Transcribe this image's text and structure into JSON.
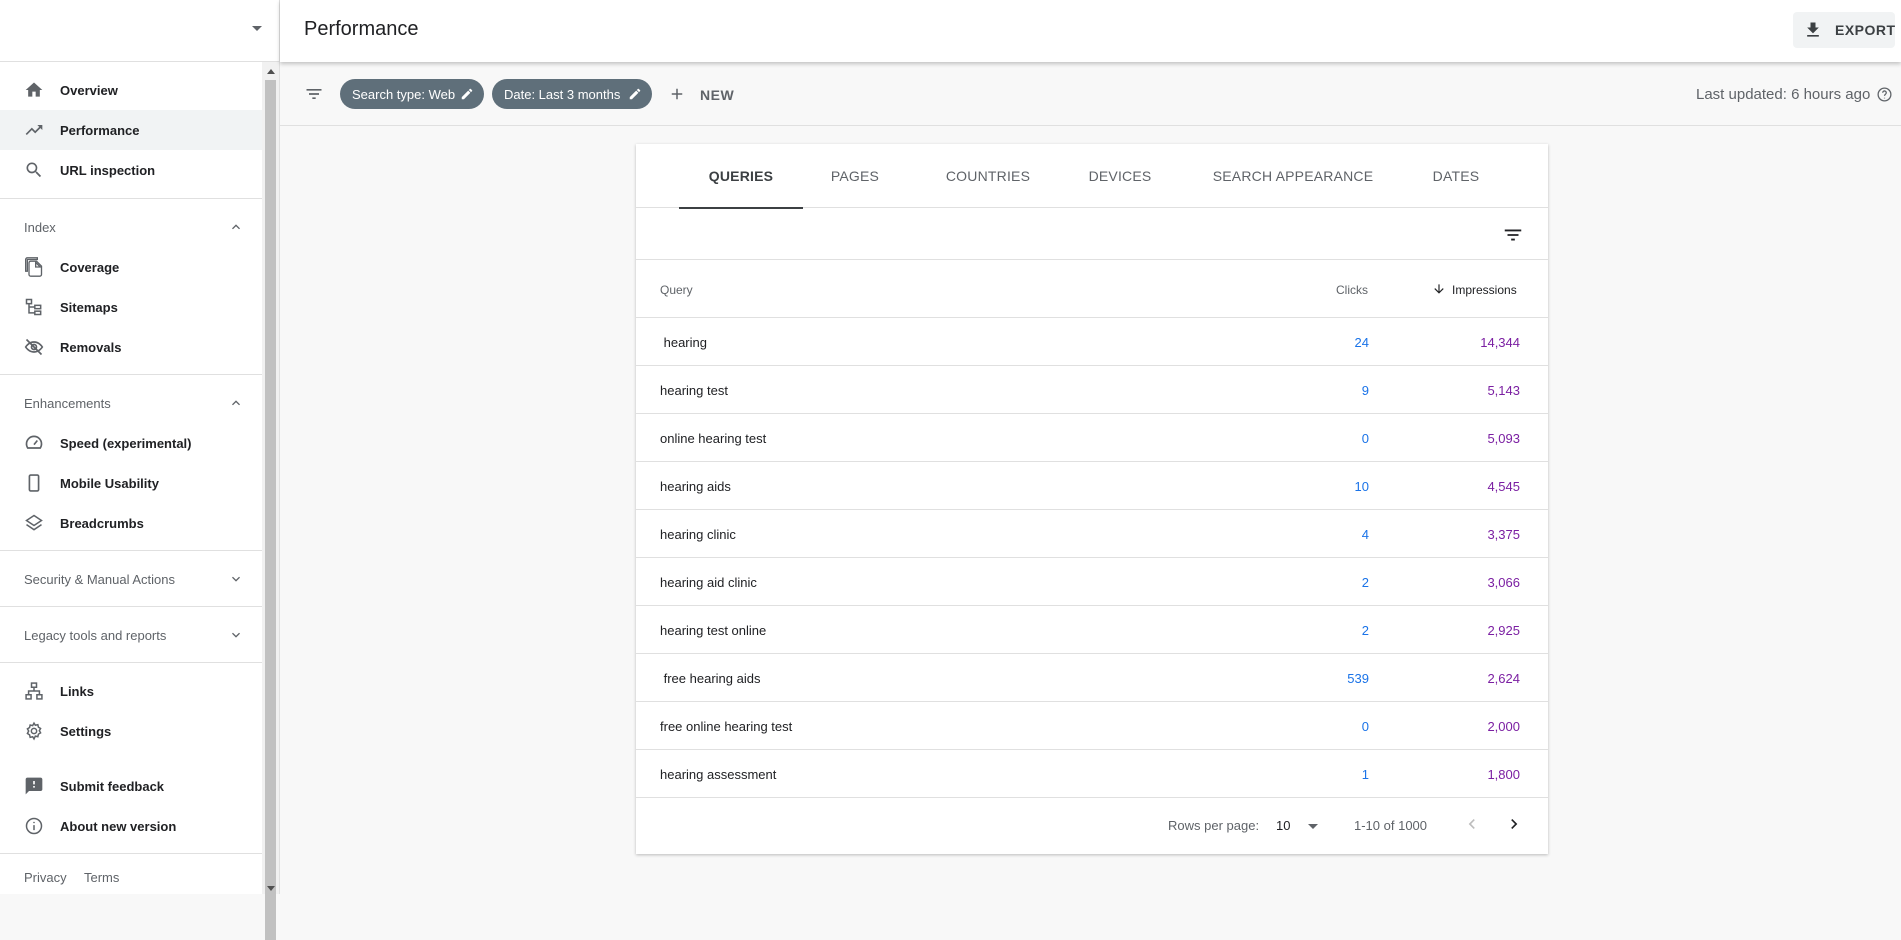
{
  "sidebar": {
    "items": [
      {
        "label": "Overview",
        "icon": "home-icon"
      },
      {
        "label": "Performance",
        "icon": "trending-up-icon"
      },
      {
        "label": "URL inspection",
        "icon": "search-icon"
      }
    ],
    "sections": [
      {
        "label": "Index",
        "expanded": true
      },
      {
        "label": "Enhancements",
        "expanded": true
      },
      {
        "label": "Security & Manual Actions",
        "expanded": false
      },
      {
        "label": "Legacy tools and reports",
        "expanded": false
      }
    ],
    "index_items": [
      {
        "label": "Coverage",
        "icon": "file-copy-icon"
      },
      {
        "label": "Sitemaps",
        "icon": "sitemap-icon"
      },
      {
        "label": "Removals",
        "icon": "eye-off-icon"
      }
    ],
    "enhancement_items": [
      {
        "label": "Speed (experimental)",
        "icon": "speedometer-icon"
      },
      {
        "label": "Mobile Usability",
        "icon": "phone-icon"
      },
      {
        "label": "Breadcrumbs",
        "icon": "layers-icon"
      }
    ],
    "bottom_items": [
      {
        "label": "Links",
        "icon": "links-icon"
      },
      {
        "label": "Settings",
        "icon": "gear-icon"
      },
      {
        "label": "Submit feedback",
        "icon": "feedback-icon"
      },
      {
        "label": "About new version",
        "icon": "info-icon"
      }
    ],
    "footer": {
      "privacy": "Privacy",
      "terms": "Terms"
    }
  },
  "header": {
    "title": "Performance",
    "export_label": "EXPORT"
  },
  "filters": {
    "chips": [
      {
        "label": "Search type: Web"
      },
      {
        "label": "Date: Last 3 months"
      }
    ],
    "new_label": "NEW",
    "last_updated": "Last updated: 6 hours ago"
  },
  "card": {
    "tabs": [
      "QUERIES",
      "PAGES",
      "COUNTRIES",
      "DEVICES",
      "SEARCH APPEARANCE",
      "DATES"
    ],
    "active_tab": "QUERIES",
    "columns": {
      "query": "Query",
      "clicks": "Clicks",
      "impressions": "Impressions"
    },
    "sorted_column": "Impressions",
    "rows": [
      {
        "query": " hearing",
        "clicks": "24",
        "impressions": "14,344"
      },
      {
        "query": "hearing test",
        "clicks": "9",
        "impressions": "5,143"
      },
      {
        "query": "online hearing test",
        "clicks": "0",
        "impressions": "5,093"
      },
      {
        "query": "hearing aids",
        "clicks": "10",
        "impressions": "4,545"
      },
      {
        "query": "hearing clinic",
        "clicks": "4",
        "impressions": "3,375"
      },
      {
        "query": "hearing aid clinic",
        "clicks": "2",
        "impressions": "3,066"
      },
      {
        "query": "hearing test online",
        "clicks": "2",
        "impressions": "2,925"
      },
      {
        "query": " free hearing aids",
        "clicks": "539",
        "impressions": "2,624"
      },
      {
        "query": "free online hearing test",
        "clicks": "0",
        "impressions": "2,000"
      },
      {
        "query": "hearing assessment",
        "clicks": "1",
        "impressions": "1,800"
      }
    ],
    "pager": {
      "rows_per_page_label": "Rows per page:",
      "rows_per_page_value": "10",
      "range": "1-10 of 1000"
    }
  },
  "colors": {
    "clicks": "#1a73e8",
    "impressions": "#7b1fa2",
    "chip_bg": "#5f6f7a"
  }
}
